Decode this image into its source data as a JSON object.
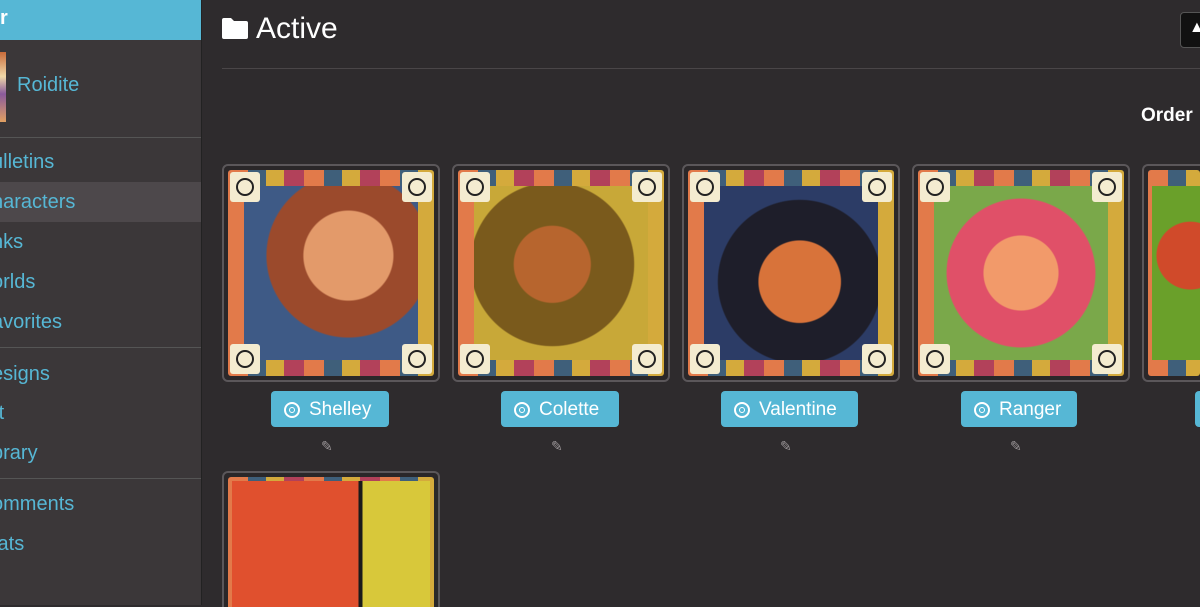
{
  "sidebar": {
    "header_text": "r",
    "username": "Roidite",
    "nav": [
      {
        "label": "ulletins"
      },
      {
        "label": "haracters"
      },
      {
        "label": "nks"
      },
      {
        "label": "orlds"
      },
      {
        "label": "avorites"
      },
      {
        "label": "esigns"
      },
      {
        "label": "rt"
      },
      {
        "label": "brary"
      },
      {
        "label": "omments"
      },
      {
        "label": "tats"
      }
    ]
  },
  "main": {
    "title": "Active",
    "order_label": "Order",
    "top_button_icon": "upload-arrow-icon",
    "characters": [
      {
        "name": "Shelley",
        "art_color": "#b85a3a"
      },
      {
        "name": "Colette",
        "art_color": "#8a6a24"
      },
      {
        "name": "Valentine",
        "art_color": "#2b3a5a"
      },
      {
        "name": "Ranger",
        "art_color": "#e06070"
      },
      {
        "name": "",
        "art_color": "#6aa02a"
      },
      {
        "name": "",
        "art_color": "#d24a36"
      }
    ]
  },
  "colors": {
    "accent": "#56b7d5",
    "background": "#2e2b2d",
    "sidebar": "#3b3739"
  }
}
